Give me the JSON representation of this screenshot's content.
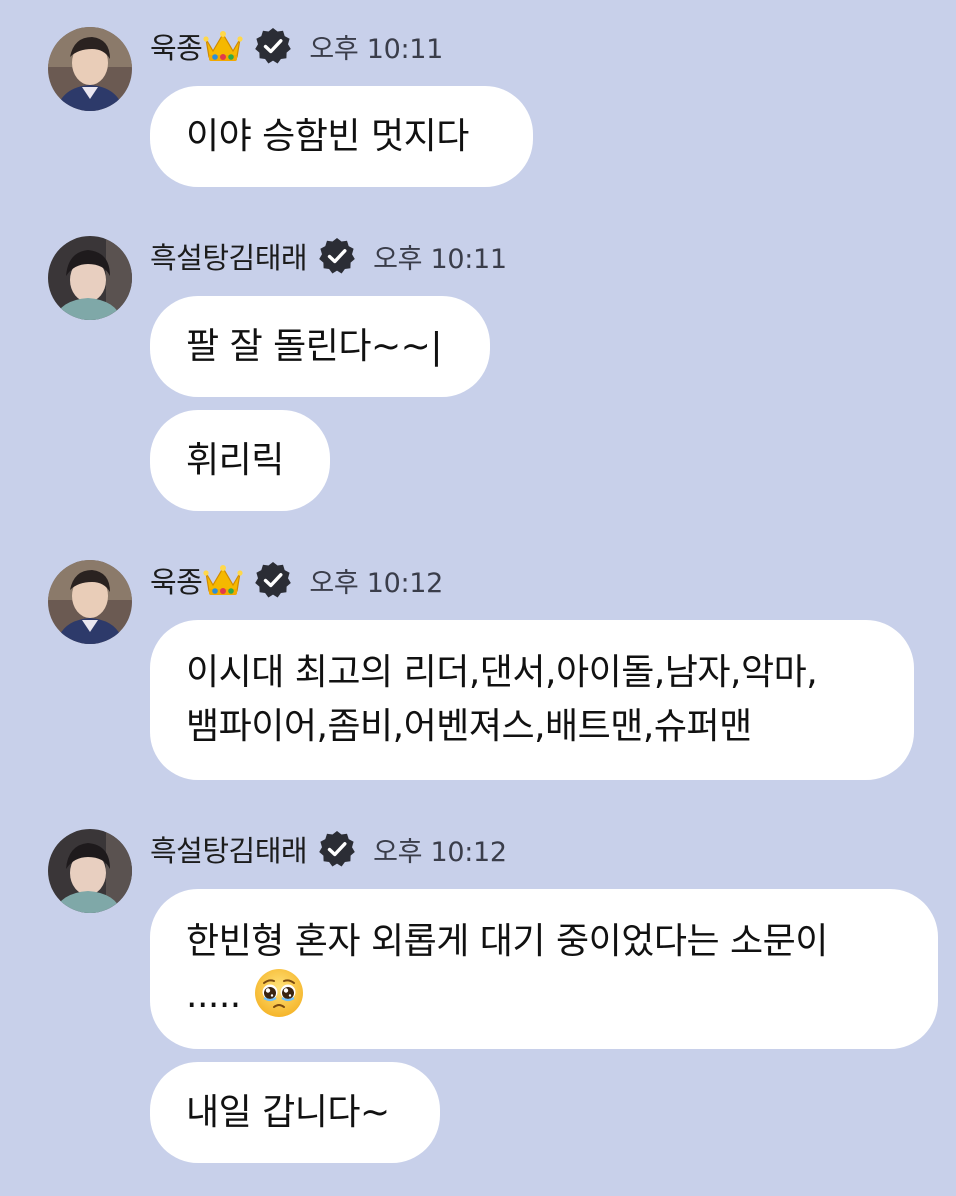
{
  "chat": {
    "messages": [
      {
        "sender": "욱종",
        "crown": true,
        "verified": true,
        "time": "오후 10:11",
        "bubbles": [
          "이야 승함빈 멋지다"
        ]
      },
      {
        "sender": "흑설탕김태래",
        "crown": false,
        "verified": true,
        "time": "오후 10:11",
        "bubbles": [
          "팔 잘 돌린다~~|",
          "휘리릭"
        ]
      },
      {
        "sender": "욱종",
        "crown": true,
        "verified": true,
        "time": "오후 10:12",
        "bubbles": [
          {
            "line1": "이시대 최고의 리더,댄서,아이돌,남자,악마,",
            "line2": "뱀파이어,좀비,어벤져스,배트맨,슈퍼맨"
          }
        ]
      },
      {
        "sender": "흑설탕김태래",
        "crown": false,
        "verified": true,
        "time": "오후 10:12",
        "bubbles": [
          {
            "line1": "한빈형 혼자 외롭게 대기 중이었다는 소문이",
            "line2": ".....",
            "emoji": "pleading-face-emoji"
          },
          "내일 갑니다~"
        ]
      }
    ]
  },
  "colors": {
    "background": "#c8d0ea",
    "bubble": "#ffffff",
    "verified_badge": "#2b2d35"
  },
  "icons": {
    "crown": "crown-icon",
    "verified": "verified-badge-icon",
    "emoji": "pleading-face-emoji"
  }
}
